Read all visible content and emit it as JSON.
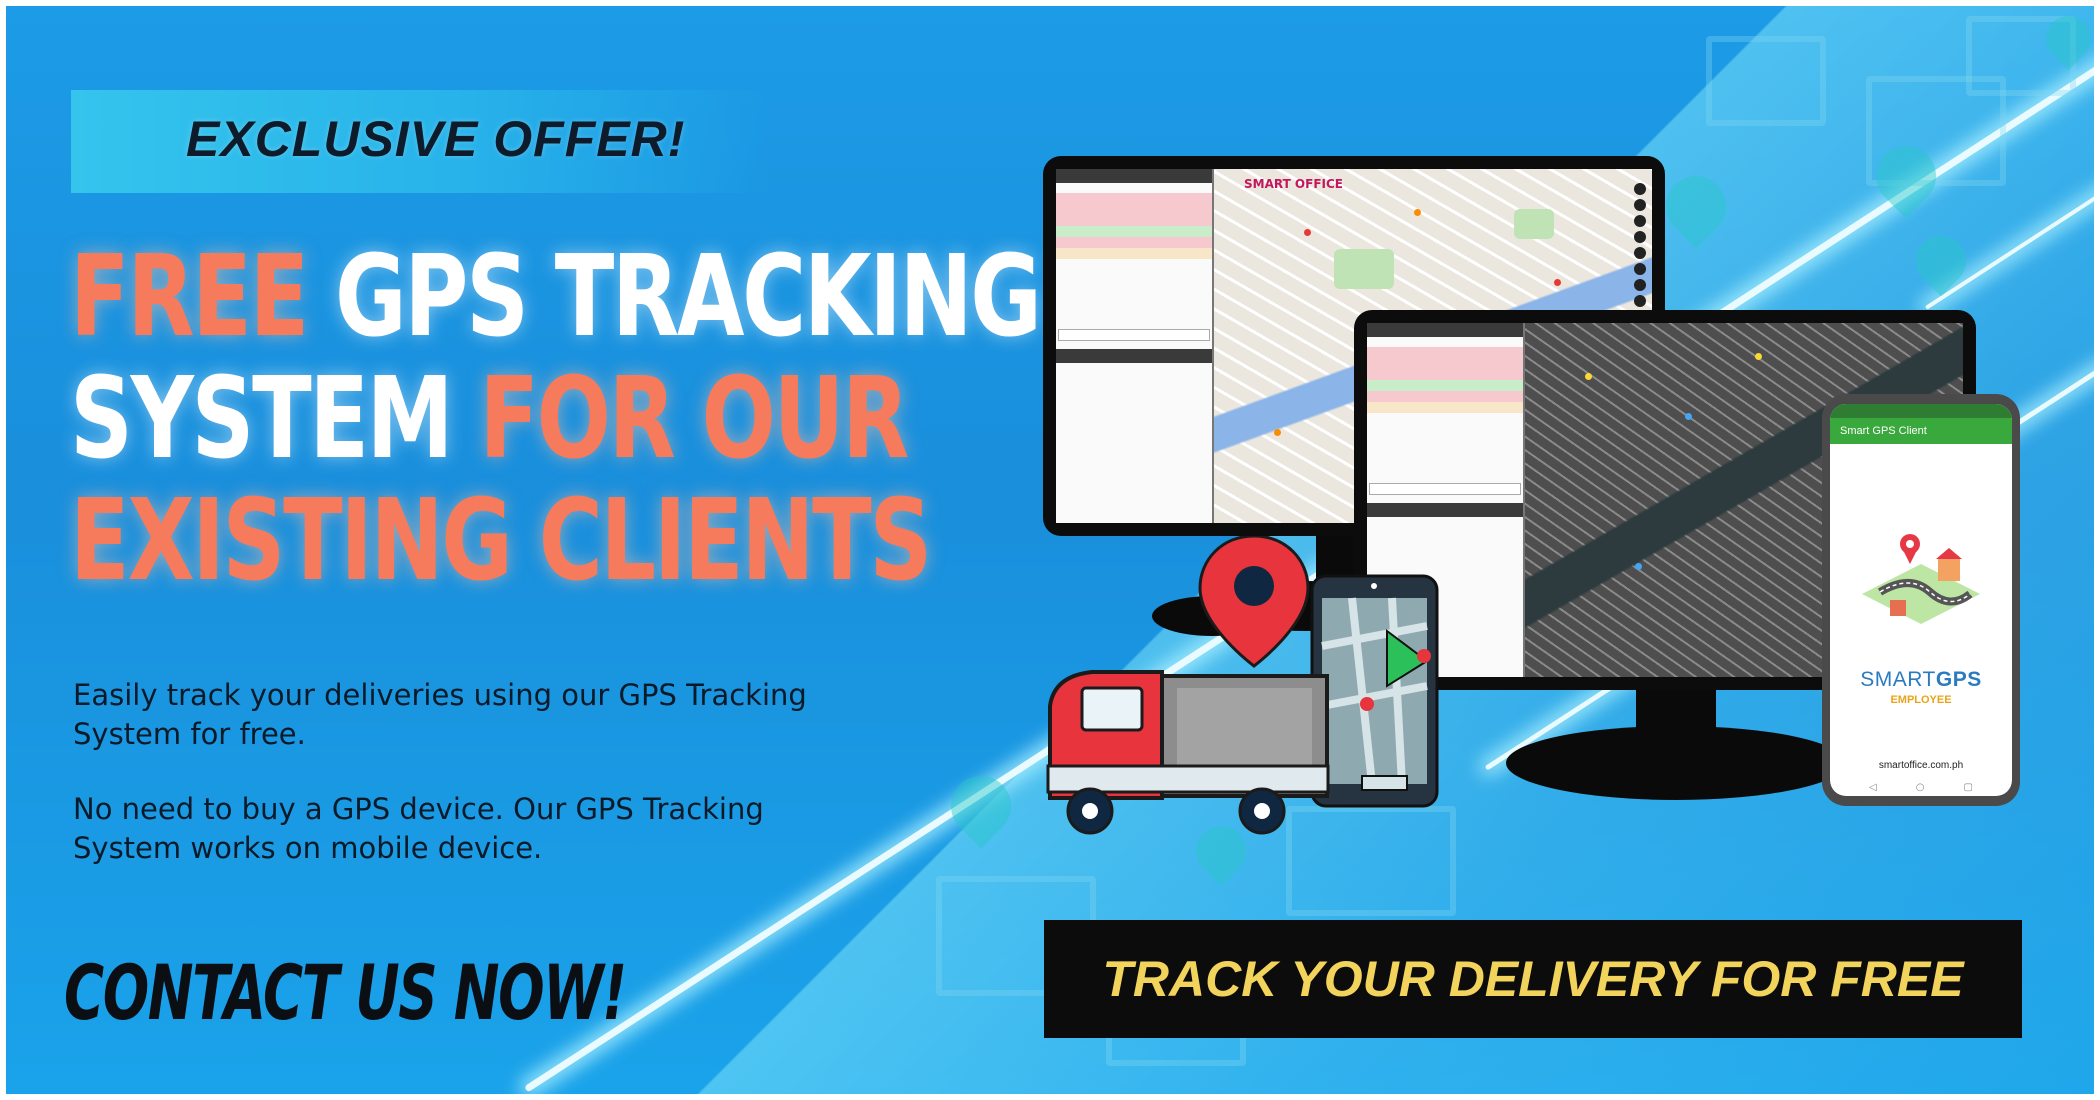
{
  "offer_label": "EXCLUSIVE OFFER!",
  "headline": {
    "line1_highlight": "FREE",
    "line1_rest": " GPS TRACKING",
    "line2_start": "SYSTEM ",
    "line2_highlight": "FOR OUR",
    "line3": "EXISTING CLIENTS"
  },
  "body": {
    "p1": "Easily track your deliveries using our GPS Tracking System for free.",
    "p2": "No need to buy a GPS device. Our GPS Tracking System works on mobile device."
  },
  "contact_label": "CONTACT US NOW!",
  "cta_label": "TRACK YOUR DELIVERY FOR FREE",
  "phone_app": {
    "title_bar": "Smart GPS Client",
    "brand_light": "SMART",
    "brand_bold": "GPS",
    "brand_sub": "EMPLOYEE",
    "url": "smartoffice.com.ph",
    "nav": [
      "◁",
      "○",
      "▢"
    ]
  },
  "monitor_logo": "SMART OFFICE",
  "colors": {
    "background": "#1c9be6",
    "headline_accent": "#f57b5c",
    "cta_background": "#0c0c0c",
    "cta_text": "#f2d35c",
    "offer_box": "#34c4ec"
  },
  "icons": [
    "map-pin-icon",
    "delivery-truck-icon",
    "smartphone-map-icon",
    "desktop-monitor-icon"
  ]
}
